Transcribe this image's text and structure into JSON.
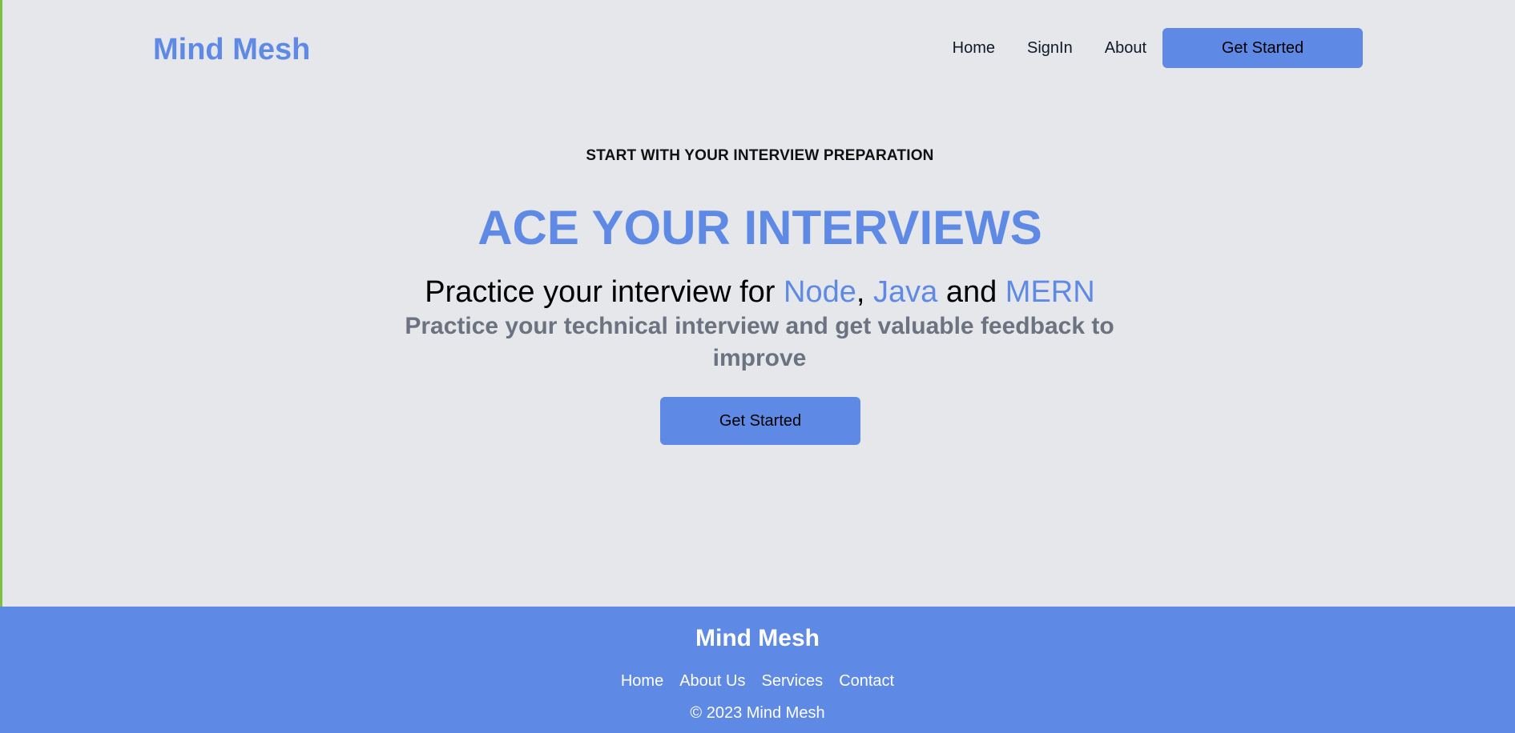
{
  "header": {
    "logo": "Mind Mesh",
    "nav": {
      "home": "Home",
      "signin": "SignIn",
      "about": "About",
      "cta": "Get Started"
    }
  },
  "hero": {
    "eyebrow": "START WITH YOUR INTERVIEW PREPARATION",
    "headline": "ACE YOUR INTERVIEWS",
    "practice": {
      "prefix": "Practice your interview for ",
      "tech1": "Node",
      "comma": ", ",
      "tech2": "Java",
      "and": " and ",
      "tech3": "MERN"
    },
    "subtext": "Practice your technical interview and get valuable feedback to improve",
    "cta": "Get Started"
  },
  "footer": {
    "title": "Mind Mesh",
    "links": [
      "Home",
      "About Us",
      "Services",
      "Contact"
    ],
    "copyright": "© 2023 Mind Mesh"
  },
  "colors": {
    "accent": "#5e8ae6",
    "background": "#e5e7eb",
    "muted_text": "#6b7280"
  }
}
